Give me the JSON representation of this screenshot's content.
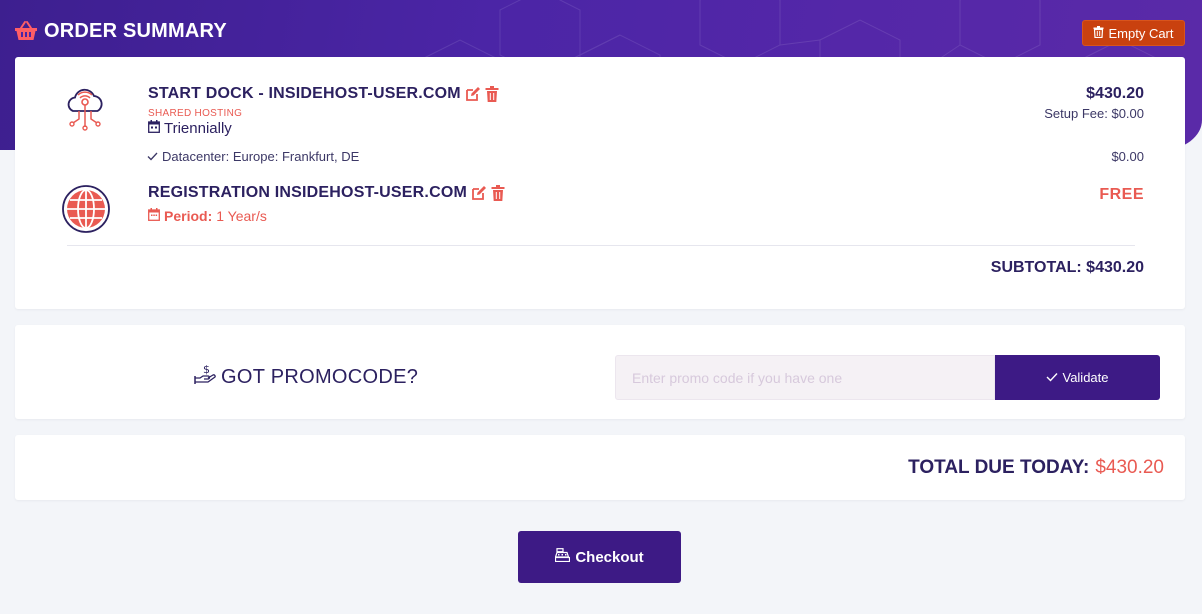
{
  "header": {
    "title": "ORDER SUMMARY",
    "empty_cart_label": "Empty Cart"
  },
  "items": [
    {
      "title": "START DOCK - INSIDEHOST-USER.COM",
      "group": "SHARED HOSTING",
      "cycle": "Triennially",
      "price": "$430.20",
      "setup_fee": "Setup Fee: $0.00",
      "config": "Datacenter: Europe: Frankfurt, DE",
      "config_price": "$0.00"
    },
    {
      "title": "REGISTRATION INSIDEHOST-USER.COM",
      "period_label": "Period:",
      "period_value": "1 Year/s",
      "price": "FREE"
    }
  ],
  "subtotal": "SUBTOTAL: $430.20",
  "promo": {
    "label": "GOT PROMOCODE?",
    "placeholder": "Enter promo code if you have one",
    "button_label": "Validate"
  },
  "total": {
    "label": "TOTAL DUE TODAY:",
    "amount": "$430.20"
  },
  "checkout_label": "Checkout",
  "colors": {
    "brand_purple": "#3d1a85",
    "accent_coral": "#e95a52",
    "danger_orange": "#c9410f",
    "text_dark": "#2c2160"
  },
  "icons": {
    "header": "basket-icon",
    "edit": "edit-icon",
    "delete": "trash-icon",
    "hosting": "cloud-network-icon",
    "domain": "globe-icon",
    "cycle": "calendar-icon",
    "config": "check-icon",
    "promo": "money-hand-icon",
    "checkout": "cash-register-icon"
  }
}
